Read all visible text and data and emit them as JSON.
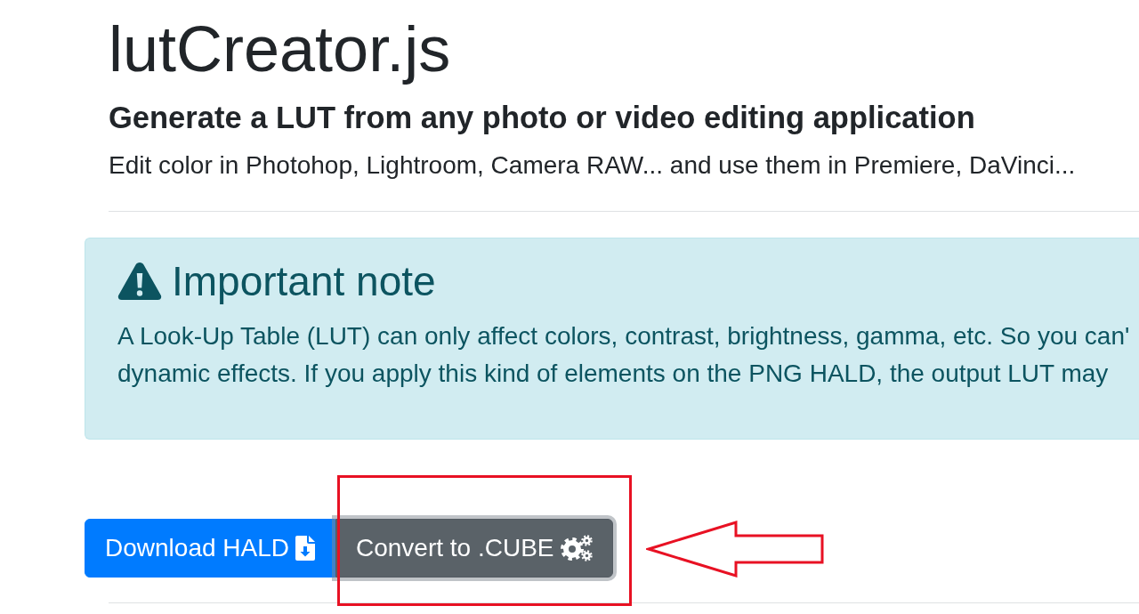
{
  "header": {
    "title": "lutCreator.js",
    "subtitle": "Generate a LUT from any photo or video editing application",
    "lead": "Edit color in Photohop, Lightroom, Camera RAW... and use them in Premiere, DaVinci..."
  },
  "alert": {
    "kind": "info",
    "heading": "Important note",
    "lines": [
      "A Look-Up Table (LUT) can only affect colors, contrast, brightness, gamma, etc. So you can'",
      "dynamic effects. If you apply this kind of elements on the PNG HALD, the output LUT may"
    ]
  },
  "buttons": [
    {
      "kind": "download",
      "label": "Download HALD",
      "focused": false,
      "highlighted": false
    },
    {
      "kind": "convert",
      "label": "Convert to .CUBE",
      "focused": true,
      "highlighted": true
    }
  ]
}
